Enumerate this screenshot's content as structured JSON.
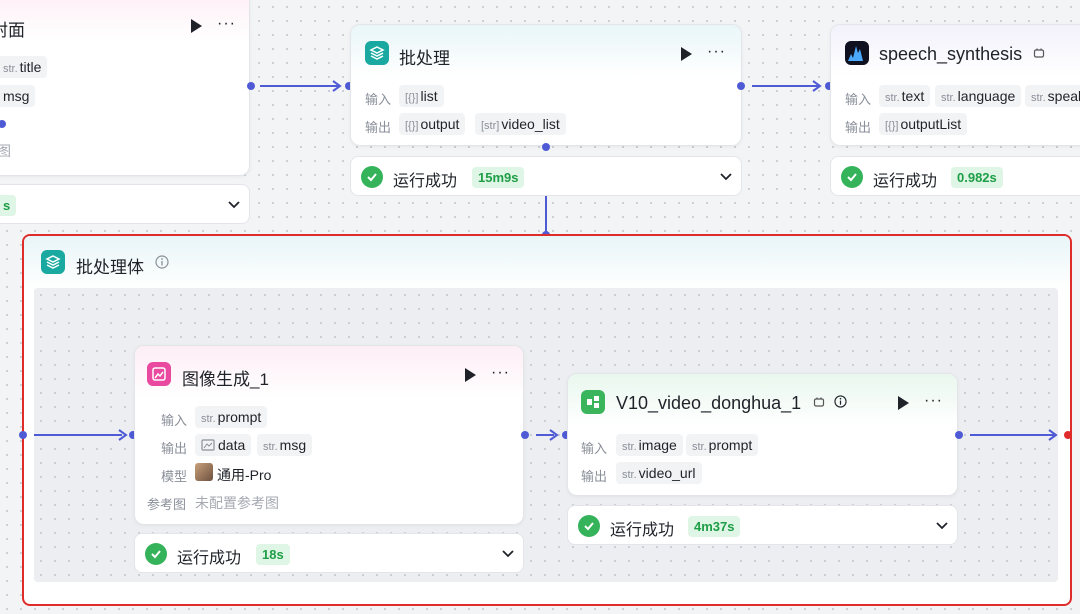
{
  "colors": {
    "accent": "#4f5bd5",
    "success": "#34b35a",
    "highlight": "#e02b2b"
  },
  "node_left": {
    "title": "封面",
    "inputs": [
      {
        "type": "str.",
        "name": "title"
      }
    ],
    "output_partial": "msg",
    "reference_partial": "图",
    "badge_partial": "s"
  },
  "batch": {
    "title": "批处理",
    "icon": "layers-icon",
    "in_label": "输入",
    "out_label": "输出",
    "inputs": [
      {
        "type": "[{}]",
        "name": "list"
      }
    ],
    "outputs": [
      {
        "type": "[{}]",
        "name": "output"
      },
      {
        "type": "[str]",
        "name": "video_list"
      }
    ],
    "status": "运行成功",
    "duration": "15m9s"
  },
  "speech": {
    "title": "speech_synthesis",
    "icon": "audio-wave-icon",
    "in_label": "输入",
    "out_label": "输出",
    "inputs": [
      {
        "type": "str.",
        "name": "text"
      },
      {
        "type": "str.",
        "name": "language"
      },
      {
        "type": "str.",
        "name": "speak"
      }
    ],
    "outputs": [
      {
        "type": "[{}]",
        "name": "outputList"
      }
    ],
    "status": "运行成功",
    "duration": "0.982s"
  },
  "batch_body": {
    "title": "批处理体",
    "icon": "layers-icon",
    "info_icon": "info-icon"
  },
  "image_gen": {
    "title": "图像生成_1",
    "icon": "image-gen-icon",
    "in_label": "输入",
    "out_label": "输出",
    "model_label": "模型",
    "ref_label": "参考图",
    "inputs": [
      {
        "type": "str.",
        "name": "prompt"
      }
    ],
    "outputs": [
      {
        "type": "img",
        "name": "data"
      },
      {
        "type": "str.",
        "name": "msg"
      }
    ],
    "model": "通用-Pro",
    "reference": "未配置参考图",
    "status": "运行成功",
    "duration": "18s"
  },
  "video_node": {
    "title": "V10_video_donghua_1",
    "icon": "plugin-icon",
    "in_label": "输入",
    "out_label": "输出",
    "inputs": [
      {
        "type": "str.",
        "name": "image"
      },
      {
        "type": "str.",
        "name": "prompt"
      }
    ],
    "outputs": [
      {
        "type": "str.",
        "name": "video_url"
      }
    ],
    "status": "运行成功",
    "duration": "4m37s"
  }
}
